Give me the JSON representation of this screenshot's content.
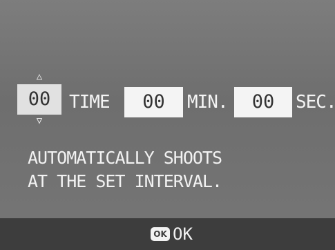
{
  "interval": {
    "time_value": "00",
    "time_unit": "TIME",
    "min_value": "00",
    "min_unit": "MIN.",
    "sec_value": "00",
    "sec_unit": "SEC.",
    "stepper_up_icon": "up-arrow-icon",
    "stepper_down_icon": "down-arrow-icon"
  },
  "message": {
    "line1": "AUTOMATICALLY SHOOTS",
    "line2": "AT THE SET INTERVAL."
  },
  "footer": {
    "ok_icon_text": "OK",
    "ok_label": "OK"
  }
}
